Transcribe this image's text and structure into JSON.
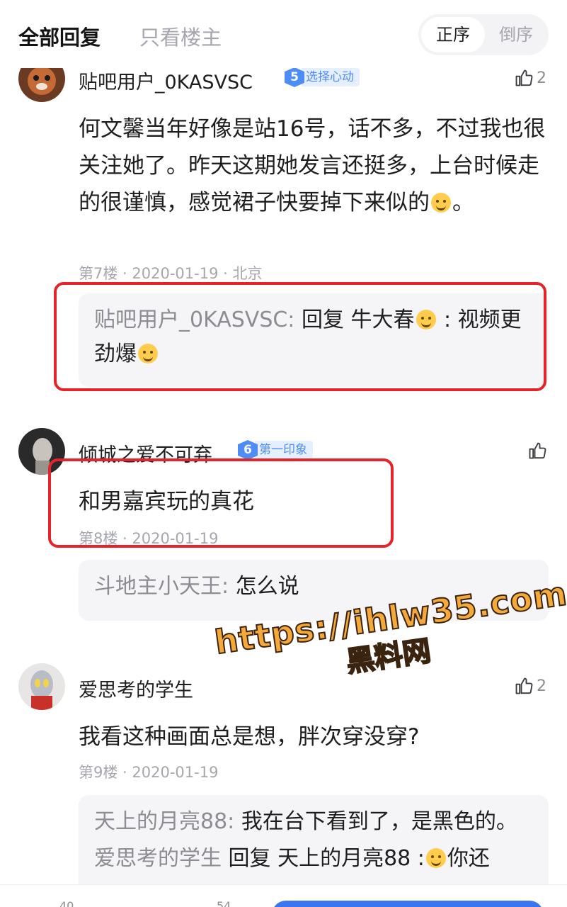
{
  "filter_bar": {
    "tab_all": "全部回复",
    "tab_op_only": "只看楼主",
    "order_asc": "正序",
    "order_desc": "倒序"
  },
  "comments": [
    {
      "username": "贴吧用户_0KASVSC",
      "level": "5",
      "level_name": "选择心动",
      "likes": "2",
      "content_before_emoji": "何文馨当年好像是站16号，话不多，不过我也很关注她了。昨天这期她发言还挺多，上台时候走的很谨慎，感觉裙子快要掉下来似的",
      "content_after_emoji": "。",
      "floor": "第7楼",
      "date": "2020-01-19",
      "location": "北京",
      "reply": {
        "user": "贴吧用户_0KASVSC:",
        "text_before": " 回复 牛大春",
        "text_after": " : 视频更劲爆"
      }
    },
    {
      "username": "倾城之爱不可弃",
      "level": "6",
      "level_name": "第一印象",
      "likes": "",
      "content": "和男嘉宾玩的真花",
      "floor": "第8楼",
      "date": "2020-01-19",
      "reply": {
        "user": "斗地主小天王:",
        "text": " 怎么说"
      }
    },
    {
      "username": "爱思考的学生",
      "likes": "2",
      "content": "我看这种画面总是想，胖次穿没穿?",
      "floor": "第9楼",
      "date": "2020-01-19",
      "reply": {
        "user": "天上的月亮88:",
        "text": " 我在台下看到了，是黑色的。",
        "partial_user": "爱思考的学生",
        "partial_text": " 回复 天上的月亮88 :",
        "partial_tail": "你还"
      }
    }
  ],
  "watermark": {
    "url": "https://ihlw35.com",
    "name": "黑料网"
  },
  "bottom_bar": {
    "count_left": "40",
    "count_mid": "54"
  },
  "colors": {
    "accent_blue": "#3b76f0",
    "highlight_red": "#e3242b",
    "watermark_orange": "#f4a93a"
  }
}
